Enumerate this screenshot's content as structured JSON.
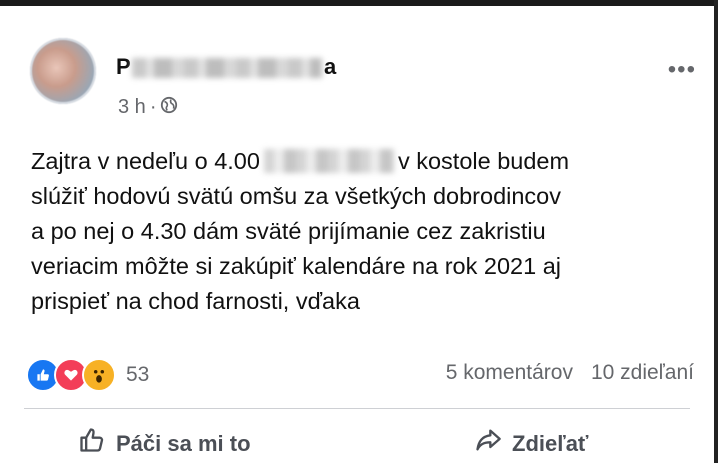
{
  "post": {
    "author_start": "P",
    "author_end": "a",
    "time": "3 h",
    "separator": "·",
    "lines": {
      "l1a": "Zajtra v nedeľu o 4.00",
      "l1b": "v kostole budem",
      "l2": "slúžiť hodovú svätú omšu za všetkých dobrodincov",
      "l3": "a po nej o 4.30 dám sväté prijímanie cez zakristiu",
      "l4": "veriacim môžte si zakúpiť kalendáre na rok 2021 aj",
      "l5": "prispieť na chod farnosti, vďaka"
    }
  },
  "reactions": {
    "count": "53",
    "comments": "5 komentárov",
    "shares": "10 zdieľaní"
  },
  "actions": {
    "like": "Páči sa mi to",
    "share": "Zdieľať"
  },
  "icons": [
    "globe-icon",
    "more-icon",
    "like-reaction-icon",
    "love-reaction-icon",
    "wow-reaction-icon",
    "thumbs-up-icon",
    "share-arrow-icon"
  ],
  "colors": {
    "accent": "#1877f2",
    "love": "#f33e58",
    "wow": "#f7b125",
    "secondary_text": "#65676b"
  }
}
